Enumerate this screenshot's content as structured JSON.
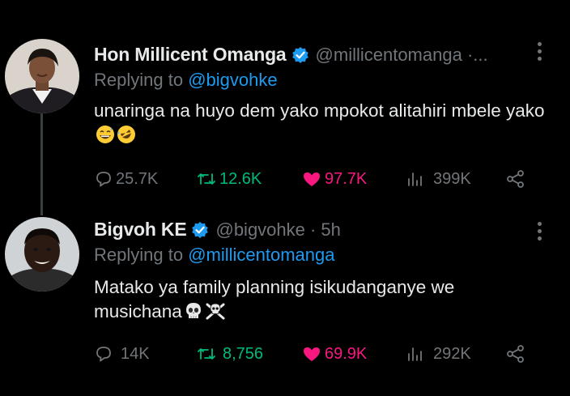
{
  "tweets": [
    {
      "display_name": "Hon Millicent Omanga",
      "handle_meta": "@millicentomanga ·...",
      "reply_prefix": "Replying to",
      "reply_to": "@bigvohke",
      "text": "unaringa na huyo dem yako mpokot alitahiri mbele yako",
      "emojis": [
        "grinning-sweat-emoji",
        "rolling-laughing-emoji"
      ],
      "stats": {
        "replies": "25.7K",
        "retweets": "12.6K",
        "likes": "97.7K",
        "views": "399K"
      }
    },
    {
      "display_name": "Bigvoh KE",
      "handle_meta": "@bigvohke · 5h",
      "reply_prefix": "Replying to",
      "reply_to": "@millicentomanga",
      "text": "Matako ya family planning isikudanganye we musichana",
      "emojis": [
        "skull-emoji",
        "skull-crossbones-emoji"
      ],
      "stats": {
        "replies": "14K",
        "retweets": "8,756",
        "likes": "69.9K",
        "views": "292K"
      }
    }
  ],
  "colors": {
    "background": "#000000",
    "text": "#e7e9ea",
    "muted": "#71767b",
    "link": "#1d9bf0",
    "like": "#f91880",
    "verified": "#1d9bf0"
  }
}
